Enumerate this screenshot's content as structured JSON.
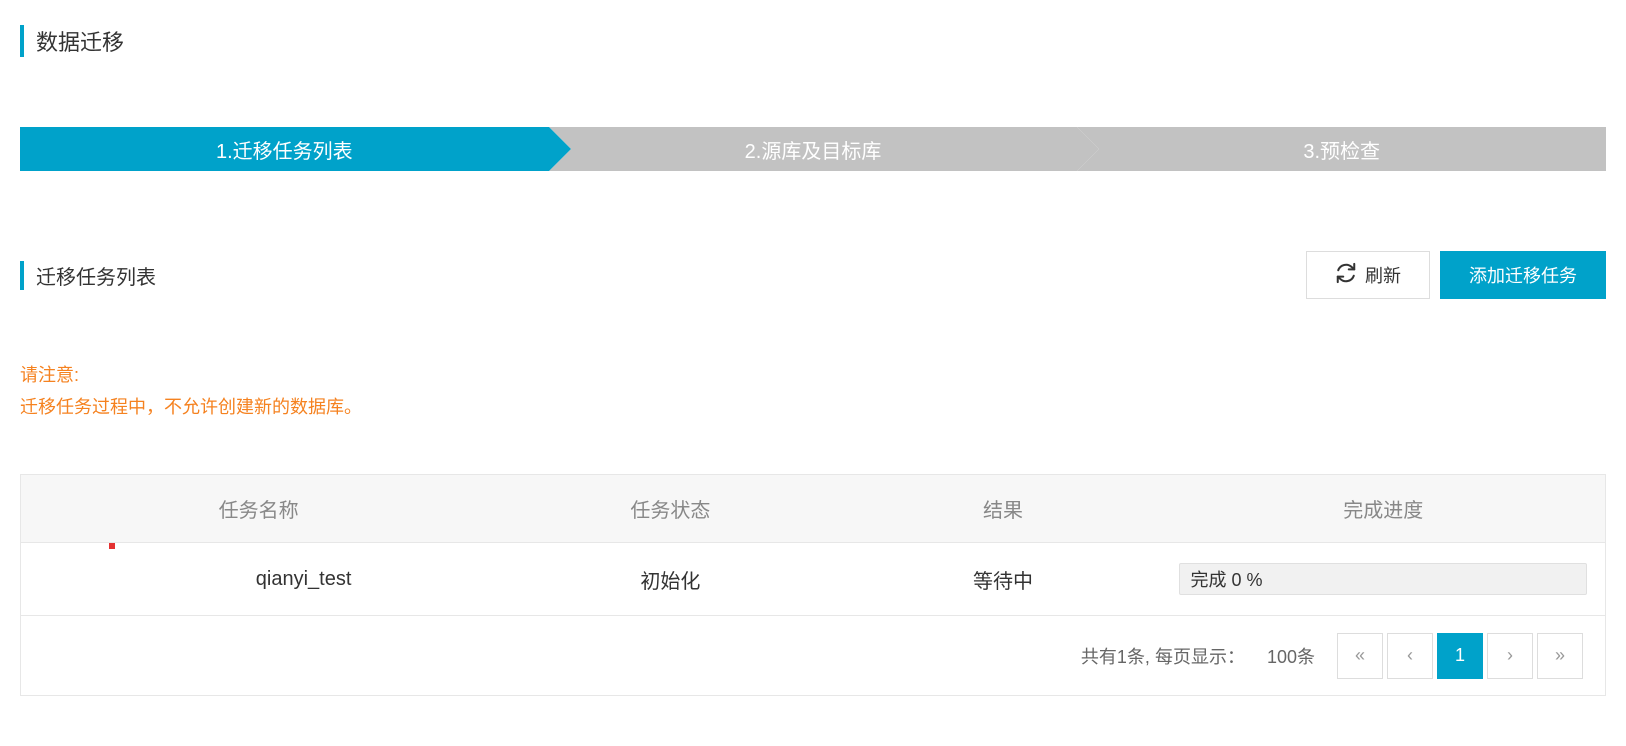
{
  "page": {
    "title": "数据迁移"
  },
  "steps": [
    {
      "label": "1.迁移任务列表",
      "active": true
    },
    {
      "label": "2.源库及目标库",
      "active": false
    },
    {
      "label": "3.预检查",
      "active": false
    }
  ],
  "section": {
    "title": "迁移任务列表",
    "refresh_label": "刷新",
    "add_task_label": "添加迁移任务"
  },
  "notice": {
    "title": "请注意:",
    "body": "迁移任务过程中，不允许创建新的数据库。"
  },
  "table": {
    "headers": [
      "任务名称",
      "任务状态",
      "结果",
      "完成进度"
    ],
    "rows": [
      {
        "name": "qianyi_test",
        "status": "初始化",
        "result": "等待中",
        "progress_label": "完成 0 %",
        "progress_value": 0
      }
    ]
  },
  "pagination": {
    "summary_prefix": "共有",
    "total": "1",
    "summary_suffix": "条, 每页显示：",
    "page_size": "100条",
    "first": "«",
    "prev": "‹",
    "current": "1",
    "next": "›",
    "last": "»"
  }
}
